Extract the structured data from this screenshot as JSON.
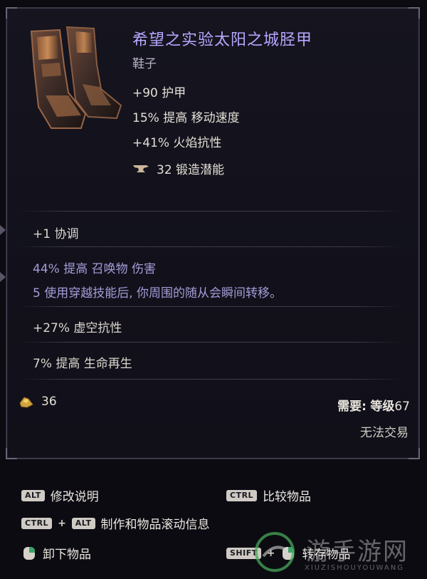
{
  "tooltip": {
    "title": "希望之实验太阳之城胫甲",
    "item_type": "鞋子",
    "implicits": [
      "+90 护甲",
      "15% 提高 移动速度",
      "+41% 火焰抗性"
    ],
    "forging_potential": {
      "icon": "anvil-icon",
      "label": "32 锻造潜能"
    },
    "affixes": [
      {
        "text": "+1 协调",
        "color": "#dcd7ce"
      },
      {
        "text": "44% 提高 召唤物 伤害",
        "color": "#a49cd8"
      },
      {
        "text": "5 使用穿越技能后, 你周围的随从会瞬间转移。",
        "color": "#a49cd8"
      },
      {
        "text": "+27% 虚空抗性",
        "color": "#dcd7ce"
      },
      {
        "text": "7% 提高 生命再生",
        "color": "#dcd7ce"
      }
    ],
    "gold": {
      "icon": "gold-coin-icon",
      "value": "36"
    },
    "requirement": {
      "label": "需要:",
      "level_label": "等级",
      "level": "67"
    },
    "trade_status": "无法交易",
    "accent_color": "#b9a7ff"
  },
  "hints": [
    {
      "keys": [
        "ALT"
      ],
      "label": "修改说明"
    },
    {
      "keys": [
        "CTRL"
      ],
      "label": "比较物品"
    },
    {
      "keys": [
        "CTRL",
        "ALT"
      ],
      "label": "制作和物品滚动信息"
    },
    {
      "keys": [],
      "mouse": "right-mouse-icon",
      "label": "卸下物品"
    },
    {
      "keys": [
        "SHIFT"
      ],
      "mouse": "right-mouse-icon",
      "label": "转存物品"
    }
  ],
  "watermark": {
    "text": "游手游网",
    "sub": "XIUZISHOUYOUWANG"
  }
}
